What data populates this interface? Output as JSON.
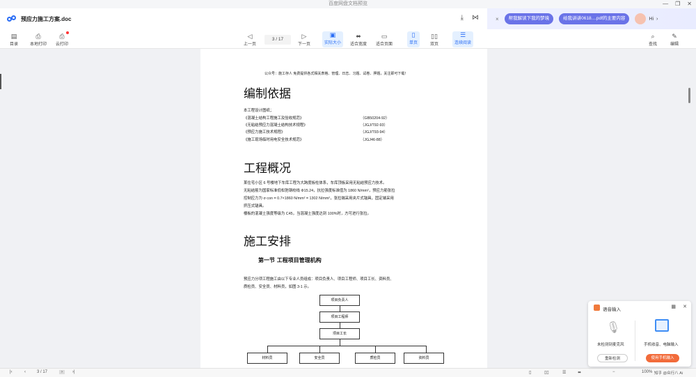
{
  "window": {
    "title": "百度网盘文档预览"
  },
  "doc": {
    "title": "预应力施工方案.doc"
  },
  "ai": {
    "close": "×",
    "suggest1": "帮我解读下我的梦境",
    "suggest2": "给我讲讲0618....pdf的主要内容",
    "greet": "Hi"
  },
  "toolbar": {
    "toc": "目录",
    "local_print": "本地打印",
    "cloud_print": "云打印",
    "prev": "上一页",
    "page": "3 / 17",
    "next": "下一页",
    "actual": "实际大小",
    "fit_width": "适合宽度",
    "fit_page": "适合页面",
    "single": "单页",
    "double": "双页",
    "continuous": "连续阅读",
    "search": "查找",
    "edit": "编辑"
  },
  "paper": {
    "notice": "公众号：施工存人 免费提供各式相关表格、管理、日志、习题、试卷、押题，关注即可下载！",
    "h_basis": "编制依据",
    "basis_intro": "本工程设计图纸；",
    "basis": [
      {
        "name": "《混凝土结构工程施工及验收规范》",
        "code": "（GB50204-92）"
      },
      {
        "name": "《无粘结预应力混凝土结构技术规程》",
        "code": "（JGJ/T92-93）"
      },
      {
        "name": "《预应力施工技术规程》",
        "code": "（JGJ/T93-94）"
      },
      {
        "name": "《施工现场临时用电安全技术规范》",
        "code": "（JGJ46-88）"
      }
    ],
    "h_overview": "工程概况",
    "overview": [
      "某住宅小区 6 号楼地下车库工程为大跨度板柱体系，车库顶板采用无粘结预应力技术。",
      "无粘结筋为国家标准低松弛钢绞线 Φ15.24，抗拉强度标准值为 1860 N/mm²，预应力筋张拉",
      "控制应力为 σ con = 0.7×1860 N/mm² = 1302 N/mm²，张拉端采用夹片式锚具，固定端采用",
      "挤压式锚具。",
      "楼板的混凝土强度等级为 C45，当混凝土强度达到 100%时，方可进行张拉。"
    ],
    "h_arrange": "施工安排",
    "h_section": "第一节 工程项目管理机构",
    "section_text": [
      "预应力分项工程施工由以下专业人员组成：项目负责人、项目工程师、项目工长、资料员、",
      "质检员、安全员、材料员，如图 3-1 示。"
    ],
    "org": {
      "l1": "项目负责人",
      "l2": "项目工程师",
      "l3": "项目工长",
      "l4": [
        "材料员",
        "安全员",
        "质检员",
        "资料员"
      ]
    }
  },
  "bottom": {
    "page": "3 / 17",
    "zoom": "100%",
    "brand": "知乎 @众行八 Ai"
  },
  "voice": {
    "title": "语音输入",
    "no_mic": "未检测到麦克风",
    "devices": "手机收音、电脑输入",
    "retry": "重新检测",
    "use_phone": "使用手机输入"
  }
}
